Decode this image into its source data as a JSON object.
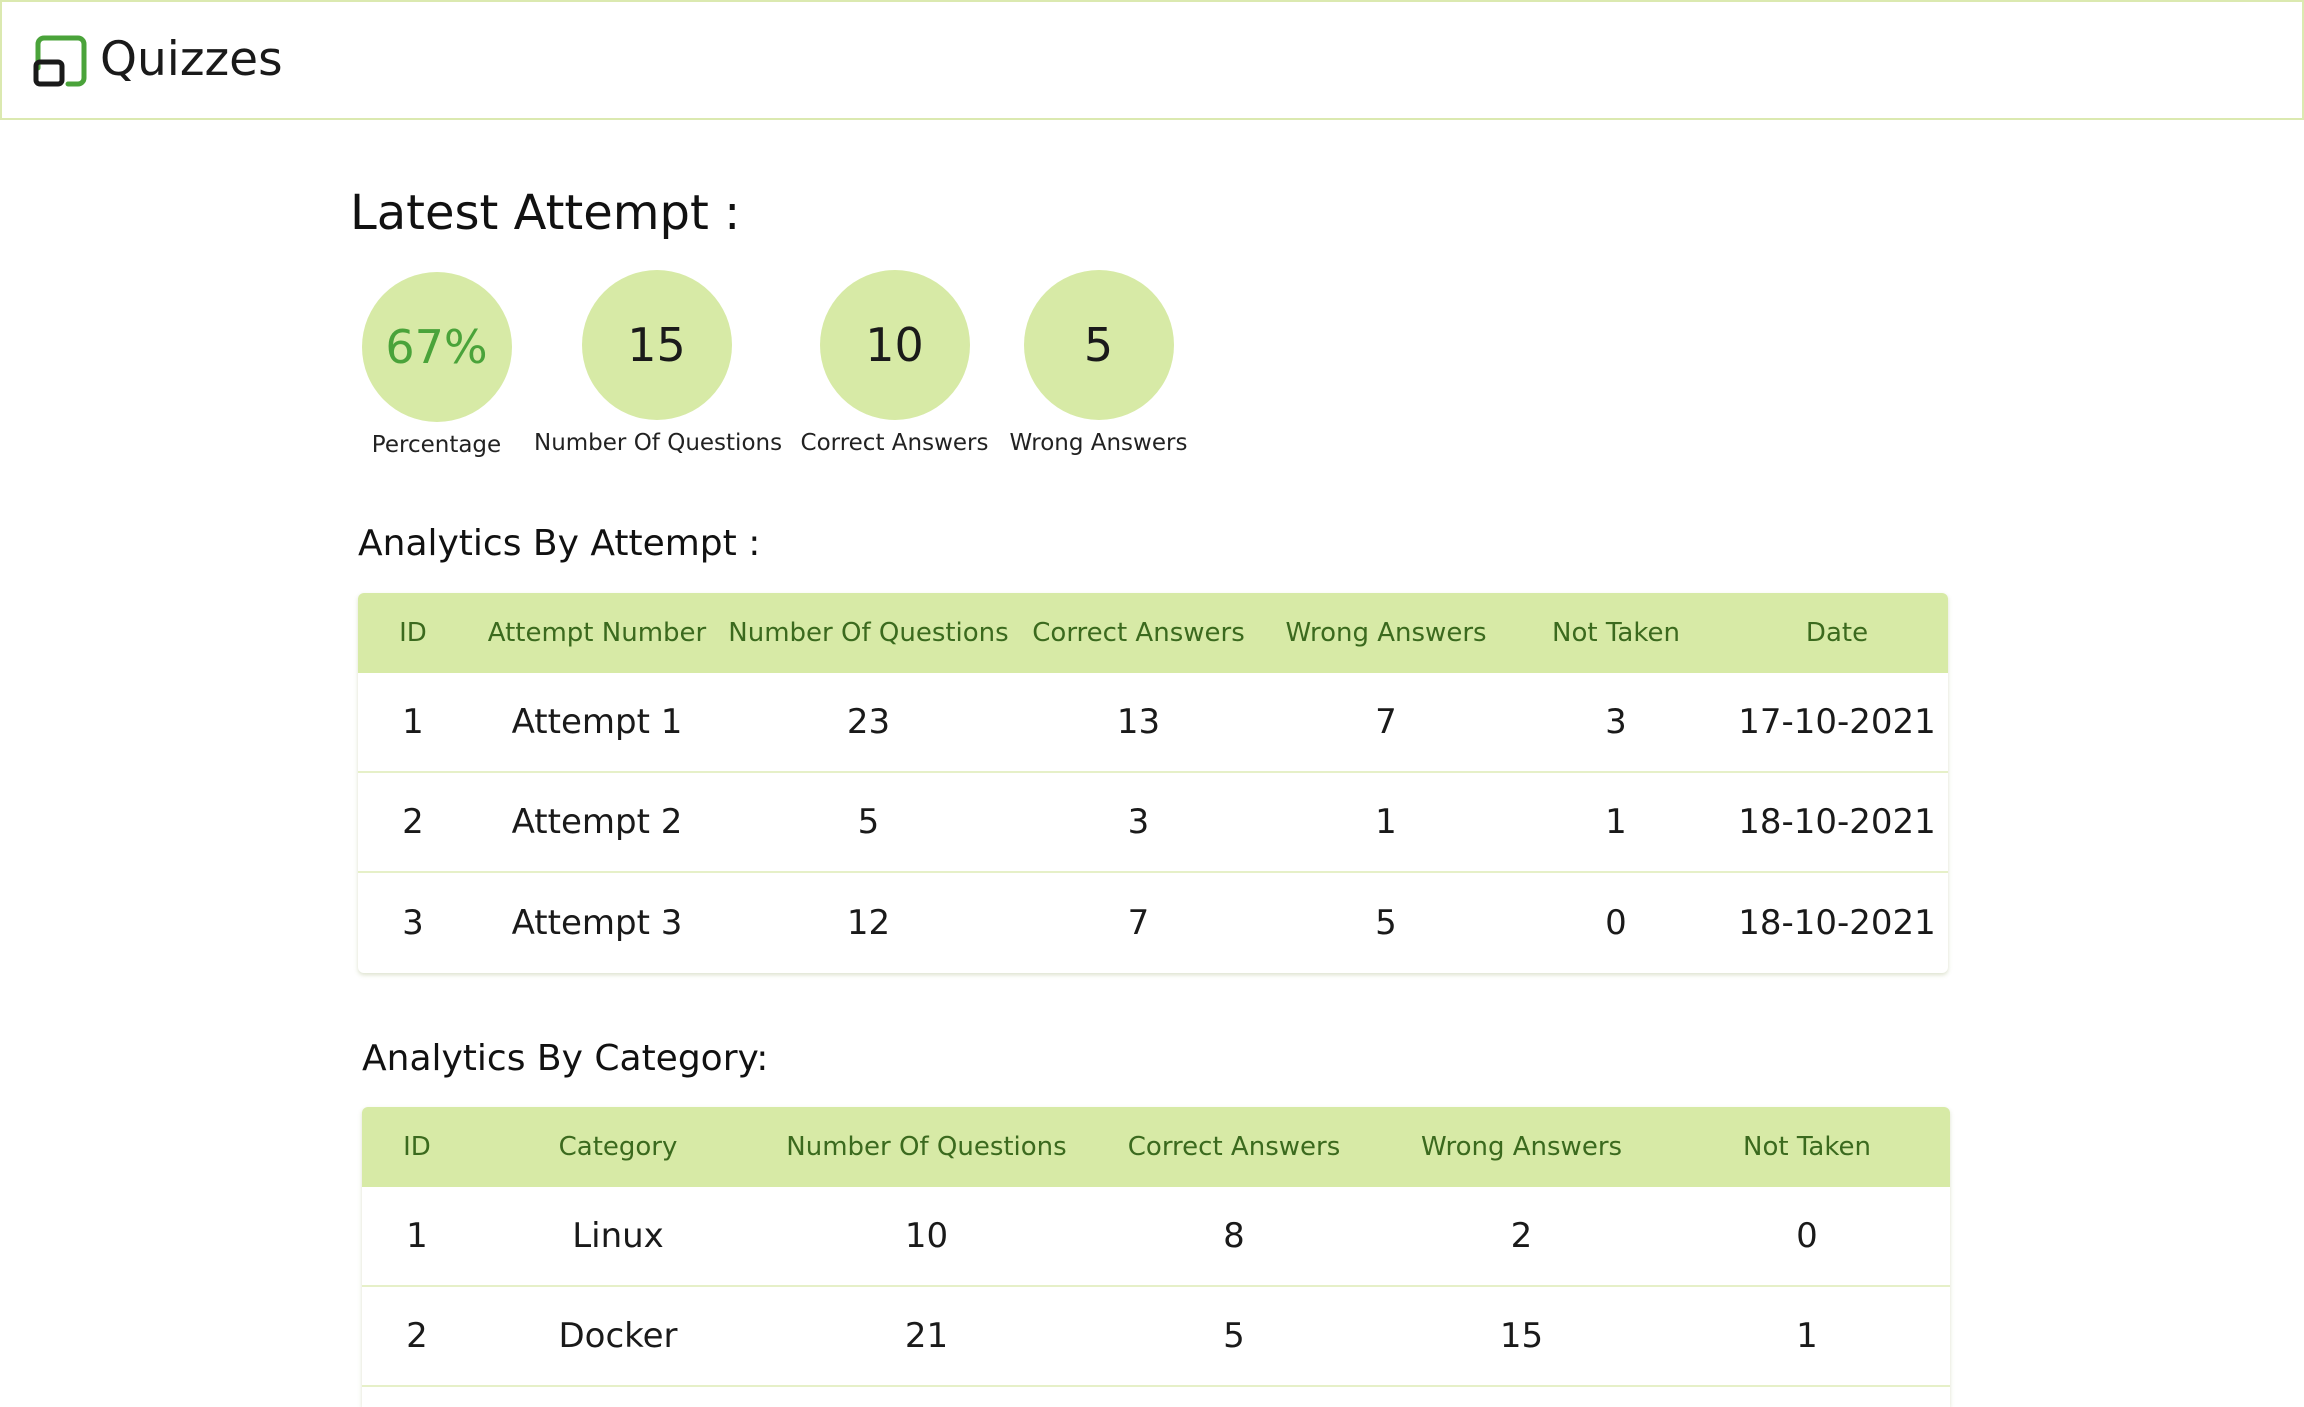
{
  "header": {
    "brand": "Quizzes"
  },
  "latest": {
    "title": "Latest Attempt :",
    "stats": [
      {
        "value": "67%",
        "label": "Percentage"
      },
      {
        "value": "15",
        "label": "Number Of Questions"
      },
      {
        "value": "10",
        "label": "Correct Answers"
      },
      {
        "value": "5",
        "label": "Wrong Answers"
      }
    ]
  },
  "attempts": {
    "title": "Analytics By Attempt :",
    "headers": [
      "ID",
      "Attempt Number",
      "Number Of Questions",
      "Correct Answers",
      "Wrong Answers",
      "Not Taken",
      "Date"
    ],
    "rows": [
      [
        "1",
        "Attempt 1",
        "23",
        "13",
        "7",
        "3",
        "17-10-2021"
      ],
      [
        "2",
        "Attempt 2",
        "5",
        "3",
        "1",
        "1",
        "18-10-2021"
      ],
      [
        "3",
        "Attempt 3",
        "12",
        "7",
        "5",
        "0",
        "18-10-2021"
      ]
    ]
  },
  "categories": {
    "title": "Analytics By Category:",
    "headers": [
      "ID",
      "Category",
      "Number Of Questions",
      "Correct Answers",
      "Wrong Answers",
      "Not Taken"
    ],
    "rows": [
      [
        "1",
        "Linux",
        "10",
        "8",
        "2",
        "0"
      ],
      [
        "2",
        "Docker",
        "21",
        "5",
        "15",
        "1"
      ]
    ]
  },
  "colors": {
    "accent": "#d7eaa6",
    "header_text": "#3b6a1e",
    "percent": "#4aa33a"
  },
  "icons": {
    "logo": "quiz-logo-icon"
  }
}
